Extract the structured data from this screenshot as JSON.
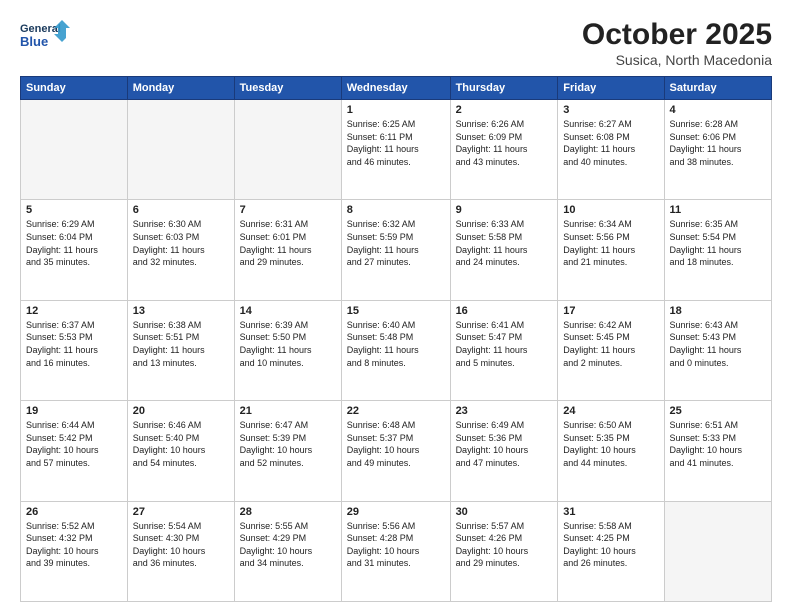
{
  "header": {
    "logo_line1": "General",
    "logo_line2": "Blue",
    "month": "October 2025",
    "location": "Susica, North Macedonia"
  },
  "weekdays": [
    "Sunday",
    "Monday",
    "Tuesday",
    "Wednesday",
    "Thursday",
    "Friday",
    "Saturday"
  ],
  "weeks": [
    [
      {
        "day": "",
        "info": ""
      },
      {
        "day": "",
        "info": ""
      },
      {
        "day": "",
        "info": ""
      },
      {
        "day": "1",
        "info": "Sunrise: 6:25 AM\nSunset: 6:11 PM\nDaylight: 11 hours\nand 46 minutes."
      },
      {
        "day": "2",
        "info": "Sunrise: 6:26 AM\nSunset: 6:09 PM\nDaylight: 11 hours\nand 43 minutes."
      },
      {
        "day": "3",
        "info": "Sunrise: 6:27 AM\nSunset: 6:08 PM\nDaylight: 11 hours\nand 40 minutes."
      },
      {
        "day": "4",
        "info": "Sunrise: 6:28 AM\nSunset: 6:06 PM\nDaylight: 11 hours\nand 38 minutes."
      }
    ],
    [
      {
        "day": "5",
        "info": "Sunrise: 6:29 AM\nSunset: 6:04 PM\nDaylight: 11 hours\nand 35 minutes."
      },
      {
        "day": "6",
        "info": "Sunrise: 6:30 AM\nSunset: 6:03 PM\nDaylight: 11 hours\nand 32 minutes."
      },
      {
        "day": "7",
        "info": "Sunrise: 6:31 AM\nSunset: 6:01 PM\nDaylight: 11 hours\nand 29 minutes."
      },
      {
        "day": "8",
        "info": "Sunrise: 6:32 AM\nSunset: 5:59 PM\nDaylight: 11 hours\nand 27 minutes."
      },
      {
        "day": "9",
        "info": "Sunrise: 6:33 AM\nSunset: 5:58 PM\nDaylight: 11 hours\nand 24 minutes."
      },
      {
        "day": "10",
        "info": "Sunrise: 6:34 AM\nSunset: 5:56 PM\nDaylight: 11 hours\nand 21 minutes."
      },
      {
        "day": "11",
        "info": "Sunrise: 6:35 AM\nSunset: 5:54 PM\nDaylight: 11 hours\nand 18 minutes."
      }
    ],
    [
      {
        "day": "12",
        "info": "Sunrise: 6:37 AM\nSunset: 5:53 PM\nDaylight: 11 hours\nand 16 minutes."
      },
      {
        "day": "13",
        "info": "Sunrise: 6:38 AM\nSunset: 5:51 PM\nDaylight: 11 hours\nand 13 minutes."
      },
      {
        "day": "14",
        "info": "Sunrise: 6:39 AM\nSunset: 5:50 PM\nDaylight: 11 hours\nand 10 minutes."
      },
      {
        "day": "15",
        "info": "Sunrise: 6:40 AM\nSunset: 5:48 PM\nDaylight: 11 hours\nand 8 minutes."
      },
      {
        "day": "16",
        "info": "Sunrise: 6:41 AM\nSunset: 5:47 PM\nDaylight: 11 hours\nand 5 minutes."
      },
      {
        "day": "17",
        "info": "Sunrise: 6:42 AM\nSunset: 5:45 PM\nDaylight: 11 hours\nand 2 minutes."
      },
      {
        "day": "18",
        "info": "Sunrise: 6:43 AM\nSunset: 5:43 PM\nDaylight: 11 hours\nand 0 minutes."
      }
    ],
    [
      {
        "day": "19",
        "info": "Sunrise: 6:44 AM\nSunset: 5:42 PM\nDaylight: 10 hours\nand 57 minutes."
      },
      {
        "day": "20",
        "info": "Sunrise: 6:46 AM\nSunset: 5:40 PM\nDaylight: 10 hours\nand 54 minutes."
      },
      {
        "day": "21",
        "info": "Sunrise: 6:47 AM\nSunset: 5:39 PM\nDaylight: 10 hours\nand 52 minutes."
      },
      {
        "day": "22",
        "info": "Sunrise: 6:48 AM\nSunset: 5:37 PM\nDaylight: 10 hours\nand 49 minutes."
      },
      {
        "day": "23",
        "info": "Sunrise: 6:49 AM\nSunset: 5:36 PM\nDaylight: 10 hours\nand 47 minutes."
      },
      {
        "day": "24",
        "info": "Sunrise: 6:50 AM\nSunset: 5:35 PM\nDaylight: 10 hours\nand 44 minutes."
      },
      {
        "day": "25",
        "info": "Sunrise: 6:51 AM\nSunset: 5:33 PM\nDaylight: 10 hours\nand 41 minutes."
      }
    ],
    [
      {
        "day": "26",
        "info": "Sunrise: 5:52 AM\nSunset: 4:32 PM\nDaylight: 10 hours\nand 39 minutes."
      },
      {
        "day": "27",
        "info": "Sunrise: 5:54 AM\nSunset: 4:30 PM\nDaylight: 10 hours\nand 36 minutes."
      },
      {
        "day": "28",
        "info": "Sunrise: 5:55 AM\nSunset: 4:29 PM\nDaylight: 10 hours\nand 34 minutes."
      },
      {
        "day": "29",
        "info": "Sunrise: 5:56 AM\nSunset: 4:28 PM\nDaylight: 10 hours\nand 31 minutes."
      },
      {
        "day": "30",
        "info": "Sunrise: 5:57 AM\nSunset: 4:26 PM\nDaylight: 10 hours\nand 29 minutes."
      },
      {
        "day": "31",
        "info": "Sunrise: 5:58 AM\nSunset: 4:25 PM\nDaylight: 10 hours\nand 26 minutes."
      },
      {
        "day": "",
        "info": ""
      }
    ]
  ]
}
